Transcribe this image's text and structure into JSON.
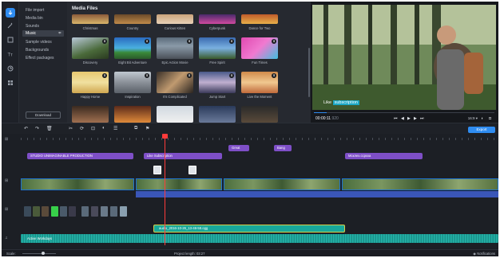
{
  "sidebar": {
    "items": [
      {
        "label": "File import"
      },
      {
        "label": "Media bin"
      },
      {
        "label": "Sounds"
      },
      {
        "label": "Music"
      },
      {
        "label": "Sample videos"
      },
      {
        "label": "Backgrounds"
      },
      {
        "label": "Effect packages"
      }
    ],
    "download_label": "Download"
  },
  "media": {
    "title": "Media Files",
    "top_row_labels": [
      "Christmas",
      "Country",
      "Curious Kitten",
      "Cyberpunk",
      "Dance for Two"
    ],
    "row1_labels": [
      "Discovery",
      "Eight Bit Adventure",
      "Epic Action Movie",
      "Free Spirit",
      "Fun Times"
    ],
    "row2_labels": [
      "Happy Home",
      "Inspiration",
      "It's Complicated",
      "Jump Start",
      "Live the Moment"
    ]
  },
  "preview": {
    "caption_prefix": "Like ",
    "caption_highlight": "subscription",
    "timecode": "00:00:11",
    "timecode_ms": ".920",
    "aspect": "16:9",
    "progress": 0.07
  },
  "toolbar": {
    "export_label": "Export"
  },
  "timeline": {
    "titles": [
      {
        "label": "STUDIO UNIMAGINABLE PRODUCTION"
      },
      {
        "label": "Like Subscription"
      },
      {
        "label": "Great"
      },
      {
        "label": "Bang"
      },
      {
        "label": "Мсклех.ссрхха"
      }
    ],
    "audio_clip_label": "audio_2016-10-26_13-46-58.ogg",
    "music_label": "Active Workdays"
  },
  "status": {
    "scale_label": "Scale:",
    "project_length_label": "Project length:",
    "project_length_value": "03:27",
    "notifications_label": "Notifications"
  },
  "colors": {
    "accent": "#2f8cf0",
    "title_clip": "#7e4fc7",
    "audio": "#18a89a",
    "playhead": "#ff3b3b"
  }
}
